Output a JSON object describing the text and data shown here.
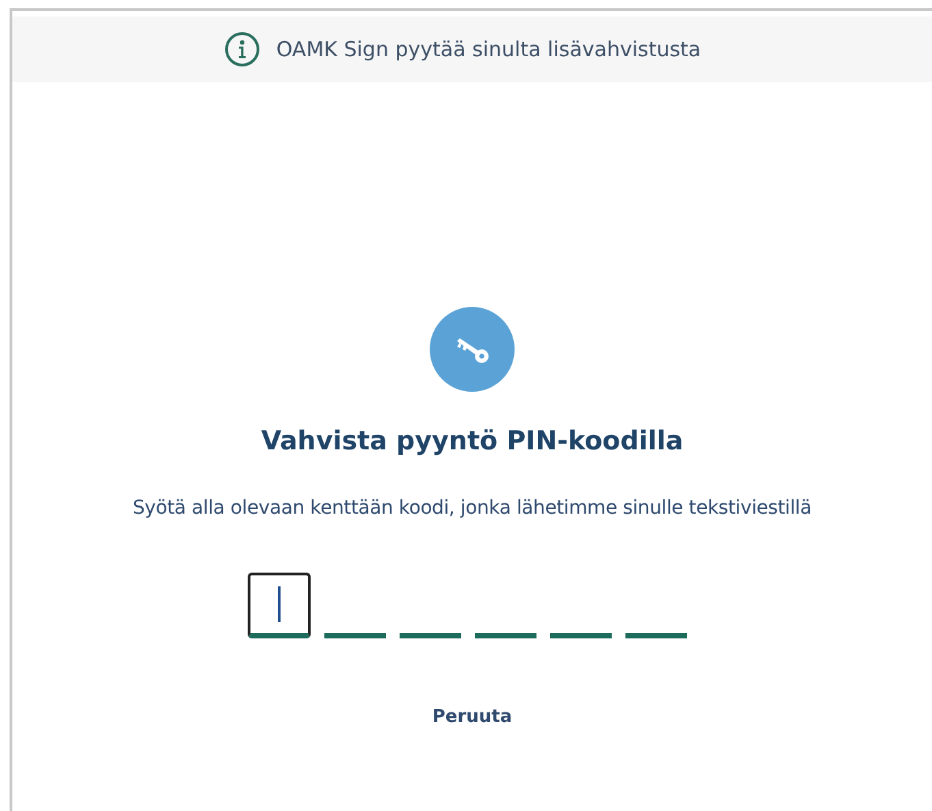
{
  "banner": {
    "text": "OAMK Sign pyytää sinulta lisävahvistusta"
  },
  "title": "Vahvista pyyntö PIN-koodilla",
  "instruction": "Syötä alla olevaan kenttään koodi, jonka lähetimme sinulle tekstiviestillä",
  "pin_fields": [
    {
      "focused": true
    },
    {
      "focused": false
    },
    {
      "focused": false
    },
    {
      "focused": false
    },
    {
      "focused": false
    },
    {
      "focused": false
    }
  ],
  "cancel": "Peruuta"
}
